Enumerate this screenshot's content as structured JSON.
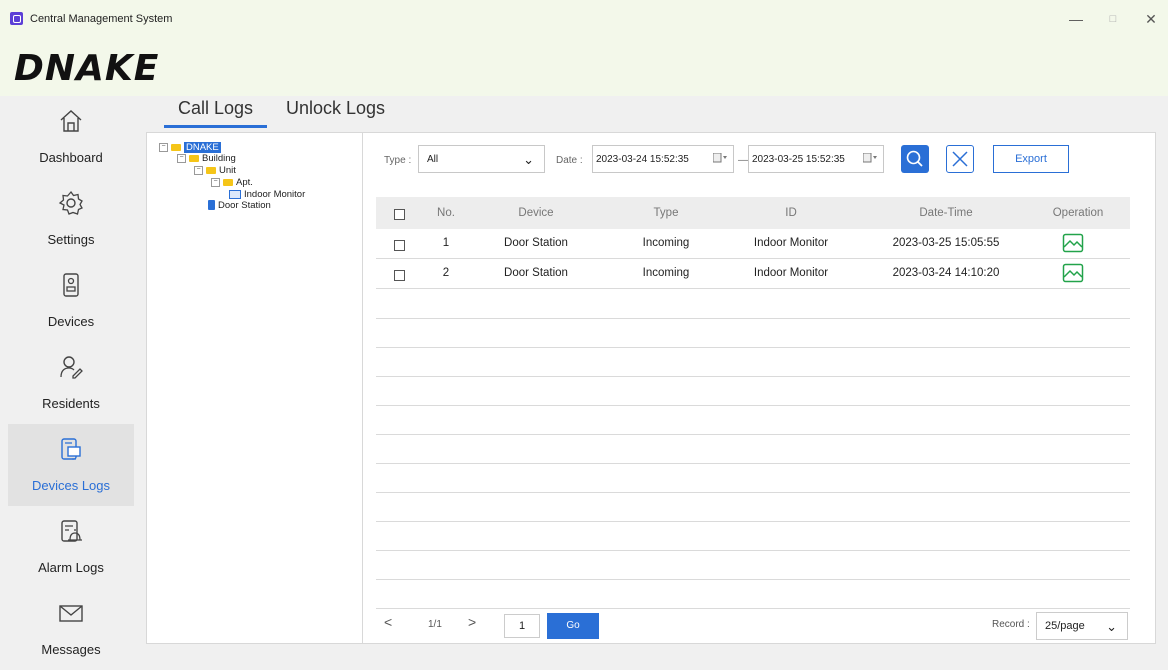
{
  "window": {
    "title": "Central Management System",
    "minimize": "—",
    "maximize": "□",
    "close": "✕"
  },
  "brand": {
    "logo_text": "DNAKE"
  },
  "sidebar": {
    "items": [
      {
        "label": "Dashboard",
        "icon": "home-icon",
        "active": false
      },
      {
        "label": "Settings",
        "icon": "gear-icon",
        "active": false
      },
      {
        "label": "Devices",
        "icon": "device-icon",
        "active": false
      },
      {
        "label": "Residents",
        "icon": "residents-icon",
        "active": false
      },
      {
        "label": "Devices Logs",
        "icon": "devices-logs-icon",
        "active": true
      },
      {
        "label": "Alarm Logs",
        "icon": "alarm-logs-icon",
        "active": false
      },
      {
        "label": "Messages",
        "icon": "envelope-icon",
        "active": false
      }
    ]
  },
  "tabs": [
    {
      "label": "Call Logs",
      "active": true
    },
    {
      "label": "Unlock Logs",
      "active": false
    }
  ],
  "tree": {
    "root": "DNAKE",
    "building": "Building",
    "unit": "Unit",
    "apt": "Apt.",
    "indoor_monitor": "Indoor Monitor",
    "door_station": "Door Station"
  },
  "filters": {
    "type_label": "Type :",
    "type_value": "All",
    "date_label": "Date :",
    "date_from": "2023-03-24 15:52:35",
    "date_sep": "—",
    "date_to": "2023-03-25 15:52:35",
    "export_label": "Export"
  },
  "table": {
    "headers": [
      "No.",
      "Device",
      "Type",
      "ID",
      "Date-Time",
      "Operation"
    ],
    "rows": [
      {
        "no": "1",
        "device": "Door Station",
        "type": "Incoming",
        "id": "Indoor Monitor",
        "datetime": "2023-03-25 15:05:55"
      },
      {
        "no": "2",
        "device": "Door Station",
        "type": "Incoming",
        "id": "Indoor Monitor",
        "datetime": "2023-03-24 14:10:20"
      }
    ]
  },
  "pager": {
    "prev": "<",
    "page_info": "1/1",
    "next": ">",
    "page_input": "1",
    "go_label": "Go",
    "record_label": "Record :",
    "record_value": "25/page"
  },
  "colors": {
    "accent": "#2a6fd6",
    "titlebar_bg": "#f3f8ea",
    "image_icon": "#22a34a"
  }
}
